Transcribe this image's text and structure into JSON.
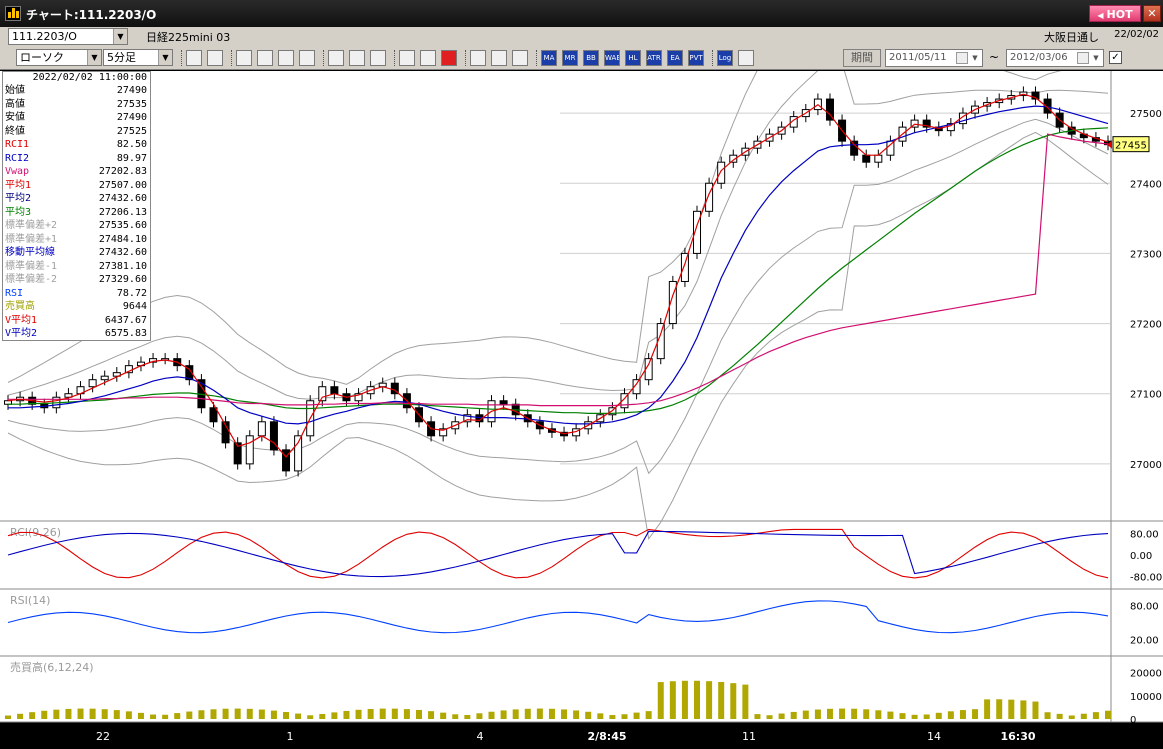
{
  "window": {
    "title": "チャート:111.2203/O",
    "hot_label": "HOT",
    "close_label": "✕"
  },
  "header": {
    "symbol_code": "111.2203/O",
    "instrument": "日経225mini 03",
    "exchange": "大阪日通し",
    "date": "22/02/02"
  },
  "toolbar": {
    "chart_type": "ローソク",
    "timeframe": "5分足",
    "buttons": [
      "zoom-icon",
      "bar-icon",
      "candle-icon",
      "line-icon",
      "point-figure-icon",
      "volume-icon",
      "draw-icon",
      "cursor-icon",
      "undo-icon",
      "box-icon",
      "box2-icon",
      "all-icon",
      "settings-icon",
      "tool-icon",
      "color-icon"
    ],
    "indicator_buttons": [
      "MA",
      "MR",
      "BB",
      "WAE",
      "HL",
      "ATR",
      "EA",
      "PVT",
      "Log"
    ],
    "period_label": "期間",
    "start_date": "2011/05/11",
    "end_date": "2012/03/06",
    "range_sep": "~",
    "check_mark": "✓"
  },
  "info": {
    "timestamp": "2022/02/02 11:00:00",
    "rows": [
      {
        "label": "始値",
        "value": "27490",
        "color": "#000000"
      },
      {
        "label": "高値",
        "value": "27535",
        "color": "#000000"
      },
      {
        "label": "安値",
        "value": "27490",
        "color": "#000000"
      },
      {
        "label": "終値",
        "value": "27525",
        "color": "#000000"
      },
      {
        "label": "RCI1",
        "value": "82.50",
        "color": "#e00000"
      },
      {
        "label": "RCI2",
        "value": "89.97",
        "color": "#0000c0"
      },
      {
        "label": "Vwap",
        "value": "27202.83",
        "color": "#d01070"
      },
      {
        "label": "平均1",
        "value": "27507.00",
        "color": "#e00000"
      },
      {
        "label": "平均2",
        "value": "27432.60",
        "color": "#000080"
      },
      {
        "label": "平均3",
        "value": "27206.13",
        "color": "#008000"
      },
      {
        "label": "標準偏差+2",
        "value": "27535.60",
        "color": "#a0a0a0"
      },
      {
        "label": "標準偏差+1",
        "value": "27484.10",
        "color": "#a0a0a0"
      },
      {
        "label": "移動平均線",
        "value": "27432.60",
        "color": "#0000c0"
      },
      {
        "label": "標準偏差-1",
        "value": "27381.10",
        "color": "#a0a0a0"
      },
      {
        "label": "標準偏差-2",
        "value": "27329.60",
        "color": "#a0a0a0"
      },
      {
        "label": "RSI",
        "value": "78.72",
        "color": "#0040ff"
      },
      {
        "label": "売買高",
        "value": "9644",
        "color": "#a0a000"
      },
      {
        "label": "V平均1",
        "value": "6437.67",
        "color": "#e00000"
      },
      {
        "label": "V平均2",
        "value": "6575.83",
        "color": "#0000c0"
      }
    ]
  },
  "colors": {
    "up_candle": "#000000",
    "down_candle": "#000000",
    "ma_short": "#e00000",
    "ma_mid": "#0000c0",
    "ma_long": "#008000",
    "vwap": "#d01070",
    "bands": "#a0a0a0",
    "rsi": "#0040ff",
    "volume": "#b0a800",
    "current_price_bg": "#ffff80"
  },
  "chart_data": [
    {
      "type": "candlestick",
      "ylim": [
        26920,
        27560
      ],
      "yticks": [
        "27000",
        "27100",
        "27200",
        "27300",
        "27400",
        "27500"
      ],
      "current_price": "27455",
      "x_ticks": [
        "22",
        "1",
        "4",
        "2/8:45",
        "11",
        "14",
        "16:30"
      ],
      "series": [
        {
          "name": "終値",
          "close": [
            27090,
            27095,
            27085,
            27080,
            27095,
            27100,
            27110,
            27120,
            27125,
            27130,
            27140,
            27145,
            27150,
            27150,
            27140,
            27120,
            27080,
            27060,
            27030,
            27000,
            27040,
            27060,
            27020,
            26990,
            27040,
            27090,
            27110,
            27100,
            27090,
            27100,
            27110,
            27115,
            27100,
            27080,
            27060,
            27040,
            27050,
            27060,
            27070,
            27060,
            27090,
            27085,
            27070,
            27060,
            27050,
            27045,
            27040,
            27050,
            27060,
            27070,
            27080,
            27100,
            27120,
            27150,
            27200,
            27260,
            27300,
            27360,
            27400,
            27430,
            27440,
            27450,
            27460,
            27470,
            27480,
            27495,
            27505,
            27520,
            27490,
            27460,
            27440,
            27430,
            27440,
            27460,
            27480,
            27490,
            27480,
            27475,
            27485,
            27500,
            27510,
            27515,
            27520,
            27525,
            27530,
            27520,
            27500,
            27480,
            27470,
            27465,
            27460,
            27455
          ]
        },
        {
          "name": "平均1",
          "values": [
            27090,
            27092,
            27090,
            27088,
            27090,
            27094,
            27100,
            27108,
            27116,
            27124,
            27132,
            27140,
            27146,
            27148,
            27145,
            27135,
            27110,
            27085,
            27055,
            27025,
            27030,
            27040,
            27030,
            27010,
            27030,
            27065,
            27095,
            27100,
            27095,
            27098,
            27105,
            27110,
            27105,
            27090,
            27070,
            27050,
            27048,
            27055,
            27063,
            27062,
            27075,
            27080,
            27075,
            27065,
            27055,
            27048,
            27043,
            27046,
            27055,
            27065,
            27076,
            27093,
            27114,
            27142,
            27185,
            27240,
            27285,
            27340,
            27385,
            27418,
            27433,
            27445,
            27455,
            27465,
            27475,
            27490,
            27500,
            27512,
            27498,
            27475,
            27455,
            27440,
            27440,
            27455,
            27470,
            27484,
            27482,
            27478,
            27482,
            27495,
            27505,
            27512,
            27518,
            27522,
            27527,
            27522,
            27508,
            27490,
            27478,
            27470,
            27464,
            27459
          ]
        },
        {
          "name": "平均2",
          "values": [
            27080,
            27080,
            27081,
            27082,
            27084,
            27086,
            27089,
            27093,
            27097,
            27102,
            27107,
            27112,
            27118,
            27122,
            27124,
            27122,
            27115,
            27105,
            27093,
            27080,
            27073,
            27068,
            27063,
            27058,
            27057,
            27060,
            27066,
            27071,
            27075,
            27080,
            27084,
            27087,
            27089,
            27088,
            27085,
            27080,
            27075,
            27071,
            27068,
            27066,
            27066,
            27066,
            27065,
            27064,
            27062,
            27060,
            27058,
            27057,
            27057,
            27058,
            27060,
            27064,
            27070,
            27080,
            27095,
            27118,
            27145,
            27180,
            27222,
            27265,
            27300,
            27333,
            27360,
            27383,
            27402,
            27418,
            27432,
            27446,
            27452,
            27454,
            27455,
            27455,
            27456,
            27460,
            27466,
            27472,
            27476,
            27480,
            27484,
            27489,
            27494,
            27498,
            27502,
            27505,
            27508,
            27510,
            27509,
            27505,
            27500,
            27495,
            27490,
            27485
          ]
        },
        {
          "name": "平均3",
          "values": [
            27085,
            27085,
            27086,
            27086,
            27087,
            27088,
            27089,
            27090,
            27091,
            27093,
            27095,
            27097,
            27099,
            27100,
            27101,
            27101,
            27099,
            27097,
            27094,
            27090,
            27088,
            27086,
            27083,
            27080,
            27079,
            27079,
            27080,
            27081,
            27082,
            27083,
            27084,
            27085,
            27085,
            27085,
            27084,
            27083,
            27082,
            27081,
            27080,
            27079,
            27078,
            27078,
            27077,
            27076,
            27075,
            27074,
            27073,
            27073,
            27072,
            27072,
            27072,
            27073,
            27074,
            27076,
            27079,
            27084,
            27091,
            27100,
            27112,
            27126,
            27140,
            27155,
            27170,
            27186,
            27202,
            27218,
            27234,
            27250,
            27265,
            27279,
            27292,
            27305,
            27318,
            27331,
            27344,
            27357,
            27369,
            27381,
            27393,
            27405,
            27417,
            27428,
            27438,
            27447,
            27455,
            27462,
            27468,
            27472,
            27475,
            27477,
            27478,
            27479
          ]
        },
        {
          "name": "Vwap",
          "values": [
            27092,
            27092,
            27092,
            27092,
            27092,
            27092,
            27092,
            27092,
            27093,
            27093,
            27094,
            27094,
            27095,
            27095,
            27095,
            27094,
            27093,
            27091,
            27089,
            27087,
            27086,
            27086,
            27085,
            27084,
            27084,
            27084,
            27085,
            27085,
            27086,
            27086,
            27086,
            27087,
            27087,
            27086,
            27086,
            27085,
            27085,
            27085,
            27085,
            27084,
            27084,
            27084,
            27084,
            27084,
            27083,
            27083,
            27083,
            27083,
            27083,
            27083,
            27083,
            27084,
            27085,
            27087,
            27090,
            27095,
            27101,
            27108,
            27116,
            27125,
            27134,
            27143,
            27152,
            27160,
            27167,
            27174,
            27180,
            27185,
            27190,
            27194,
            27197,
            27200,
            27203,
            27206,
            27209,
            27212,
            27215,
            27218,
            27221,
            27224,
            27227,
            27230,
            27233,
            27236,
            27239,
            27242,
            27470,
            27466,
            27463,
            27460,
            27458,
            27456
          ]
        }
      ]
    },
    {
      "type": "line",
      "label": "RCI(9,26)",
      "ylim": [
        -100,
        100
      ],
      "yticks": [
        "80.00",
        "0.00",
        "-80.00"
      ]
    },
    {
      "type": "line",
      "label": "RSI(14)",
      "ylim": [
        0,
        100
      ],
      "yticks": [
        "80.00",
        "20.00"
      ]
    },
    {
      "type": "bar",
      "label": "売買高(6,12,24)",
      "ylim": [
        0,
        25000
      ],
      "yticks": [
        "20000",
        "10000",
        "0"
      ]
    }
  ]
}
